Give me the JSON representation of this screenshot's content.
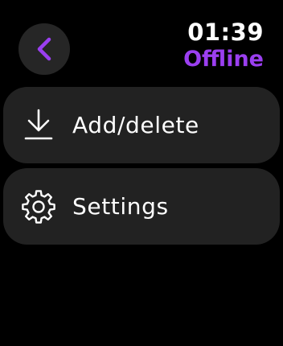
{
  "header": {
    "time": "01:39",
    "status": "Offline",
    "back_icon": "chevron-left-icon"
  },
  "menu": {
    "items": [
      {
        "label": "Add/delete",
        "icon": "download-icon"
      },
      {
        "label": "Settings",
        "icon": "gear-icon"
      }
    ]
  },
  "colors": {
    "background": "#000000",
    "card": "#222222",
    "button": "#262626",
    "accent": "#9b3ff0",
    "text": "#ffffff"
  }
}
